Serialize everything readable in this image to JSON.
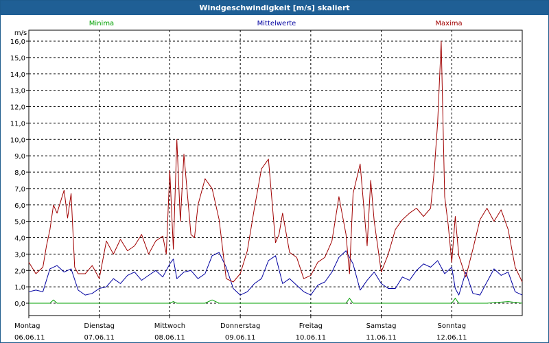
{
  "window": {
    "title": "Windgeschwindigkeit [m/s] skaliert"
  },
  "chart_data": {
    "type": "line",
    "title": "Windgeschwindigkeit [m/s] skaliert",
    "ylabel": "m/s",
    "xlabel": "",
    "ylim": [
      0,
      16
    ],
    "grid": true,
    "legend_placement": "top",
    "y_ticks": [
      "0,0",
      "1,0",
      "2,0",
      "3,0",
      "4,0",
      "5,0",
      "6,0",
      "7,0",
      "8,0",
      "9,0",
      "10,0",
      "11,0",
      "12,0",
      "13,0",
      "14,0",
      "15,0",
      "16,0"
    ],
    "x_ticks": [
      {
        "day": "Montag",
        "date": "06.06.11"
      },
      {
        "day": "Dienstag",
        "date": "07.06.11"
      },
      {
        "day": "Mittwoch",
        "date": "08.06.11"
      },
      {
        "day": "Donnerstag",
        "date": "09.06.11"
      },
      {
        "day": "Freitag",
        "date": "10.06.11"
      },
      {
        "day": "Samstag",
        "date": "11.06.11"
      },
      {
        "day": "Sonntag",
        "date": "12.06.11"
      }
    ],
    "x_range_days": [
      0,
      7
    ],
    "series": [
      {
        "name": "Minima",
        "color": "#00a000",
        "x_days": [
          0,
          0.3,
          0.35,
          0.4,
          0.5,
          1.0,
          1.5,
          2.0,
          2.05,
          2.1,
          2.5,
          2.6,
          2.7,
          3.0,
          3.5,
          4.0,
          4.5,
          4.55,
          4.6,
          5.0,
          5.5,
          6.0,
          6.05,
          6.1,
          6.5,
          6.8,
          7.0
        ],
        "values": [
          0.0,
          0.0,
          0.2,
          0.0,
          0.0,
          0.0,
          0.0,
          0.0,
          0.1,
          0.0,
          0.0,
          0.2,
          0.0,
          0.0,
          0.0,
          0.0,
          0.0,
          0.3,
          0.0,
          0.0,
          0.0,
          0.0,
          0.3,
          0.0,
          0.0,
          0.1,
          0.0
        ]
      },
      {
        "name": "Mittelwerte",
        "color": "#0000a0",
        "x_days": [
          0,
          0.1,
          0.2,
          0.3,
          0.4,
          0.5,
          0.6,
          0.7,
          0.8,
          0.9,
          1.0,
          1.1,
          1.2,
          1.3,
          1.4,
          1.5,
          1.6,
          1.7,
          1.8,
          1.9,
          2.0,
          2.05,
          2.1,
          2.2,
          2.3,
          2.4,
          2.5,
          2.6,
          2.7,
          2.8,
          2.9,
          3.0,
          3.1,
          3.2,
          3.3,
          3.4,
          3.5,
          3.6,
          3.7,
          3.8,
          3.9,
          4.0,
          4.1,
          4.2,
          4.3,
          4.4,
          4.5,
          4.6,
          4.7,
          4.8,
          4.9,
          5.0,
          5.1,
          5.2,
          5.3,
          5.4,
          5.5,
          5.6,
          5.7,
          5.8,
          5.9,
          6.0,
          6.05,
          6.1,
          6.2,
          6.3,
          6.4,
          6.5,
          6.6,
          6.7,
          6.8,
          6.9,
          7.0
        ],
        "values": [
          0.7,
          0.8,
          0.7,
          2.1,
          2.3,
          1.9,
          2.1,
          0.8,
          0.5,
          0.6,
          0.9,
          1.0,
          1.5,
          1.2,
          1.7,
          1.9,
          1.4,
          1.7,
          2.0,
          1.6,
          2.4,
          2.7,
          1.5,
          1.9,
          2.0,
          1.5,
          1.8,
          2.9,
          3.1,
          2.2,
          0.9,
          0.5,
          0.7,
          1.2,
          1.5,
          2.6,
          2.9,
          1.2,
          1.5,
          1.1,
          0.7,
          0.5,
          1.1,
          1.3,
          1.9,
          2.8,
          3.2,
          2.4,
          0.8,
          1.4,
          1.9,
          1.2,
          0.9,
          0.9,
          1.6,
          1.4,
          2.0,
          2.4,
          2.2,
          2.6,
          1.8,
          2.2,
          0.9,
          0.5,
          1.9,
          0.6,
          0.5,
          1.3,
          2.1,
          1.7,
          1.9,
          0.7,
          0.5
        ]
      },
      {
        "name": "Maxima",
        "color": "#a00000",
        "x_days": [
          0,
          0.1,
          0.2,
          0.25,
          0.3,
          0.35,
          0.4,
          0.5,
          0.55,
          0.6,
          0.65,
          0.7,
          0.8,
          0.9,
          1.0,
          1.1,
          1.2,
          1.3,
          1.4,
          1.5,
          1.6,
          1.7,
          1.8,
          1.9,
          1.95,
          2.0,
          2.05,
          2.1,
          2.15,
          2.2,
          2.3,
          2.35,
          2.4,
          2.5,
          2.6,
          2.7,
          2.8,
          2.9,
          3.0,
          3.1,
          3.2,
          3.3,
          3.4,
          3.5,
          3.55,
          3.6,
          3.7,
          3.8,
          3.9,
          4.0,
          4.1,
          4.2,
          4.3,
          4.4,
          4.5,
          4.55,
          4.6,
          4.7,
          4.8,
          4.85,
          4.9,
          5.0,
          5.1,
          5.2,
          5.3,
          5.4,
          5.5,
          5.6,
          5.7,
          5.75,
          5.8,
          5.85,
          5.9,
          5.95,
          6.0,
          6.05,
          6.1,
          6.2,
          6.3,
          6.4,
          6.5,
          6.6,
          6.7,
          6.8,
          6.9,
          7.0
        ],
        "values": [
          2.5,
          1.8,
          2.2,
          3.5,
          4.5,
          6.0,
          5.5,
          6.9,
          5.2,
          6.7,
          2.2,
          1.8,
          1.8,
          2.3,
          1.5,
          3.8,
          3.0,
          3.9,
          3.2,
          3.5,
          4.2,
          3.0,
          3.8,
          4.1,
          3.0,
          8.1,
          3.3,
          10.0,
          5.0,
          9.1,
          4.2,
          4.0,
          6.0,
          7.6,
          7.0,
          5.1,
          1.5,
          1.3,
          1.8,
          3.2,
          5.8,
          8.2,
          8.8,
          3.7,
          4.2,
          5.5,
          3.1,
          2.8,
          1.5,
          1.7,
          2.5,
          2.8,
          3.8,
          6.5,
          4.2,
          1.8,
          6.7,
          8.5,
          3.5,
          7.5,
          5.0,
          1.9,
          3.0,
          4.5,
          5.1,
          5.5,
          5.8,
          5.3,
          5.8,
          8.0,
          11.0,
          16.0,
          6.5,
          4.8,
          2.5,
          5.3,
          2.9,
          1.6,
          3.3,
          5.1,
          5.8,
          5.0,
          5.7,
          4.5,
          2.2,
          1.3
        ]
      }
    ]
  }
}
